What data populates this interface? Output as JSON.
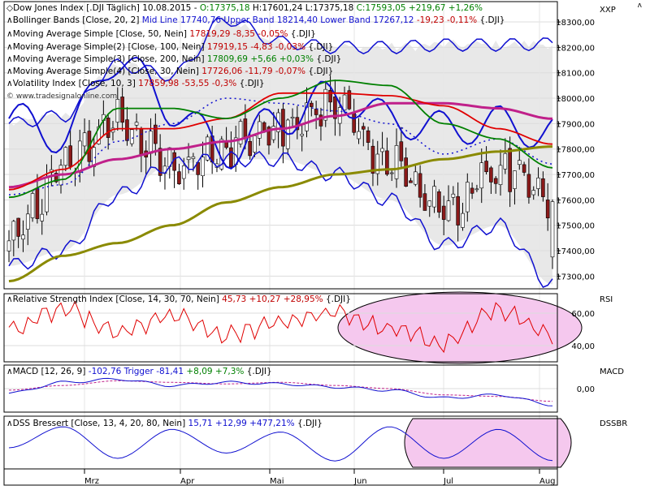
{
  "header_lines": [
    {
      "segments": [
        {
          "text": "Dow Jones Index [.DJI Täglich]  10.08.2015 - ",
          "color": "#000000"
        },
        {
          "text": "O:17375,18",
          "color": "#008000"
        },
        {
          "text": " H:17601,24 L:17375,18 ",
          "color": "#000000"
        },
        {
          "text": "C:17593,05 +219,67 +1,26%",
          "color": "#008000"
        }
      ]
    },
    {
      "segments": [
        {
          "text": "Bollinger Bands [Close, 20, 2] ",
          "color": "#000000"
        },
        {
          "text": "Mid Line 17740,76 Upper Band 18214,40 Lower Band 17267,12",
          "color": "#1010d0"
        },
        {
          "text": " -19,23 -0,11%",
          "color": "#c00000"
        },
        {
          "text": " {.DJI}",
          "color": "#000000"
        }
      ]
    },
    {
      "segments": [
        {
          "text": "Moving Average Simple [Close, 50, Nein] ",
          "color": "#000000"
        },
        {
          "text": "17819,29 -8,35 -0,05%",
          "color": "#c00000"
        },
        {
          "text": " {.DJI}",
          "color": "#000000"
        }
      ]
    },
    {
      "segments": [
        {
          "text": "Moving Average Simple(2) [Close, 100, Nein] ",
          "color": "#000000"
        },
        {
          "text": "17919,15 -4,83 -0,03%",
          "color": "#c00000"
        },
        {
          "text": " {.DJI}",
          "color": "#000000"
        }
      ]
    },
    {
      "segments": [
        {
          "text": "Moving Average Simple(3) [Close, 200, Nein] ",
          "color": "#000000"
        },
        {
          "text": "17809,69 +5,66 +0,03%",
          "color": "#008000"
        },
        {
          "text": " {.DJI}",
          "color": "#000000"
        }
      ]
    },
    {
      "segments": [
        {
          "text": "Moving Average Simple(4) [Close, 30, Nein] ",
          "color": "#000000"
        },
        {
          "text": "17726,06 -11,79 -0,07%",
          "color": "#c00000"
        },
        {
          "text": " {.DJI}",
          "color": "#000000"
        }
      ]
    },
    {
      "segments": [
        {
          "text": "Volatility Index [Close, 10, 3] ",
          "color": "#000000"
        },
        {
          "text": "17859,98 -53,55 -0,3%",
          "color": "#c00000"
        },
        {
          "text": " {.DJI}",
          "color": "#000000"
        }
      ]
    }
  ],
  "watermark": "© www.tradesignalonline.com",
  "axis_labels": {
    "main": "XXP",
    "rsi": "RSI",
    "macd": "MACD",
    "dss": "DSSBR"
  },
  "x_labels": [
    "Mrz",
    "Apr",
    "Mai",
    "Jun",
    "Jul",
    "Aug"
  ],
  "colors": {
    "bollinger": "#1010d0",
    "ma50": "#e00000",
    "ma100": "#c0208a",
    "ma200": "#8a8a00",
    "ma30": "#008000",
    "volatility": "#1010d0",
    "up_candle": "#ffffff",
    "down_candle": "#8b1a1a",
    "rsi": "#e00000",
    "macd": "#1010d0",
    "macd_trigger": "#c0208a",
    "dss": "#1010d0",
    "highlight_fill": "#f5c8ee",
    "band_fill": "#e8e8e8"
  },
  "chart_data": [
    {
      "type": "candlestick",
      "title": "Dow Jones Index [.DJI Täglich]",
      "ylim": [
        17250,
        18380
      ],
      "yticks": [
        17300,
        17400,
        17500,
        17600,
        17700,
        17800,
        17900,
        18000,
        18100,
        18200,
        18300
      ],
      "ytick_labels": [
        "17300,00",
        "17400,00",
        "17500,00",
        "17600,00",
        "17700,00",
        "17800,00",
        "17900,00",
        "18000,00",
        "18100,00",
        "18200,00",
        "18300,00"
      ],
      "last": {
        "open": 17375.18,
        "high": 17601.24,
        "low": 17375.18,
        "close": 17593.05
      },
      "series_keys": [
        17640,
        17640,
        17735,
        17755,
        17760,
        17795,
        17810,
        17806,
        17745,
        17760,
        17741
      ],
      "anchors": {
        "close": [
          17420,
          17730,
          17920,
          17720,
          17820,
          17880,
          17970,
          17750,
          17550,
          17720,
          17593
        ],
        "upper": [
          17900,
          17930,
          18130,
          18090,
          18310,
          18220,
          18200,
          18200,
          18210,
          18210,
          18214
        ],
        "lower": [
          17340,
          17400,
          17620,
          17740,
          17760,
          17760,
          17700,
          17600,
          17420,
          17500,
          17267
        ],
        "mid": [
          17620,
          17660,
          17830,
          17900,
          18000,
          17980,
          17950,
          17900,
          17780,
          17840,
          17741
        ],
        "ma50": [
          17640,
          17720,
          17880,
          17880,
          17920,
          18020,
          18020,
          18010,
          17970,
          17880,
          17819
        ],
        "ma100": [
          17650,
          17700,
          17760,
          17800,
          17830,
          17880,
          17930,
          17980,
          17980,
          17960,
          17919
        ],
        "ma200": [
          17280,
          17380,
          17430,
          17500,
          17590,
          17650,
          17700,
          17720,
          17760,
          17790,
          17810
        ],
        "ma30": [
          17610,
          17680,
          17960,
          17960,
          17920,
          18000,
          18070,
          18050,
          17900,
          17840,
          17726
        ],
        "vola": [
          17920,
          17850,
          18160,
          17960,
          17790,
          17920,
          18010,
          17920,
          17880,
          17900,
          17860
        ]
      }
    },
    {
      "type": "line",
      "name": "Relative Strength Index [Close, 14, 30, 70, Nein]",
      "last_value": 45.73,
      "change": "+10,27 +28,95%",
      "ylim": [
        30,
        72
      ],
      "yticks": [
        40,
        60
      ],
      "ytick_labels": [
        "40,00",
        "60,00"
      ],
      "anchors": [
        50,
        62,
        48,
        58,
        46,
        55,
        60,
        50,
        42,
        62,
        45.73
      ]
    },
    {
      "type": "line",
      "name": "MACD [12, 26, 9]",
      "macd_last": -102.76,
      "trigger_last": -81.41,
      "change": "+8,09 +7,3%",
      "ylim": [
        -150,
        150
      ],
      "yticks": [
        0
      ],
      "ytick_labels": [
        "0,00"
      ],
      "anchors_macd": [
        -30,
        40,
        60,
        20,
        40,
        30,
        10,
        -10,
        -60,
        -40,
        -102.76
      ],
      "anchors_trigger": [
        -10,
        20,
        50,
        40,
        30,
        40,
        20,
        0,
        -40,
        -50,
        -81.41
      ]
    },
    {
      "type": "line",
      "name": "DSS Bressert [Close, 13, 4, 20, 80, Nein]",
      "last_value": 15.71,
      "change": "+12,99 +477,21%",
      "ylim": [
        0,
        100
      ],
      "anchors": [
        40,
        80,
        20,
        75,
        30,
        70,
        15,
        80,
        20,
        75,
        15.71
      ]
    }
  ]
}
